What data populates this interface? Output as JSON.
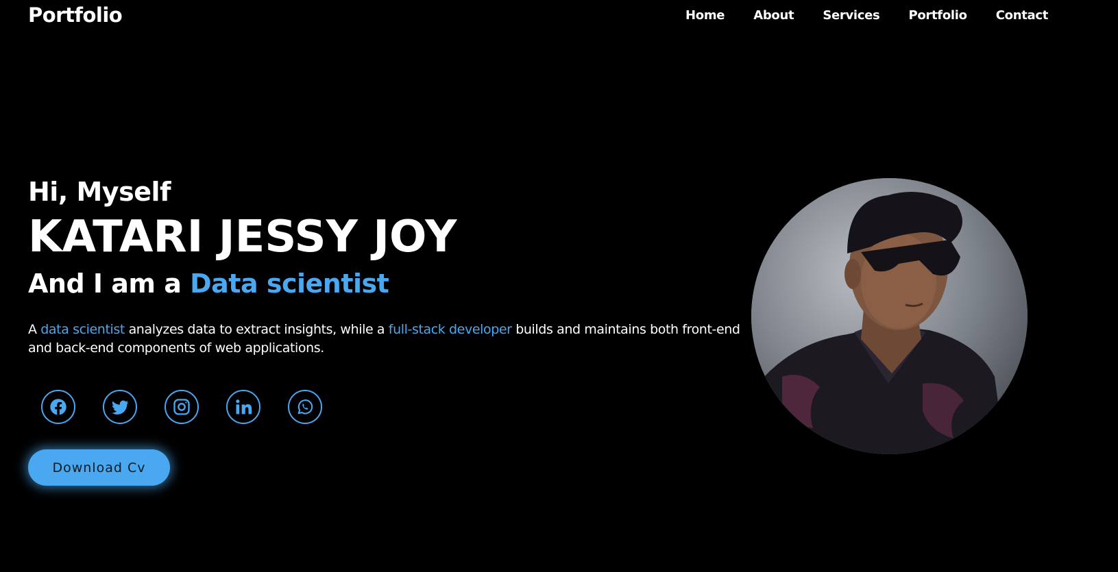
{
  "header": {
    "logo": "Portfolio",
    "nav": [
      "Home",
      "About",
      "Services",
      "Portfolio",
      "Contact"
    ]
  },
  "hero": {
    "greeting": "Hi, Myself",
    "name": "KATARI JESSY JOY",
    "role_prefix": "And I am a",
    "role_highlight": "Data scientist",
    "desc_1": "A",
    "desc_link_1": "data scientist",
    "desc_2": "analyzes data to extract insights, while a",
    "desc_link_2": "full-stack developer",
    "desc_3": "builds and maintains both front-end and back-end components of web applications.",
    "download_label": "Download Cv"
  },
  "socials": [
    "facebook-icon",
    "twitter-icon",
    "instagram-icon",
    "linkedin-icon",
    "whatsapp-icon"
  ],
  "colors": {
    "background": "#000000",
    "accent": "#4aa8f0",
    "text": "#ffffff"
  }
}
